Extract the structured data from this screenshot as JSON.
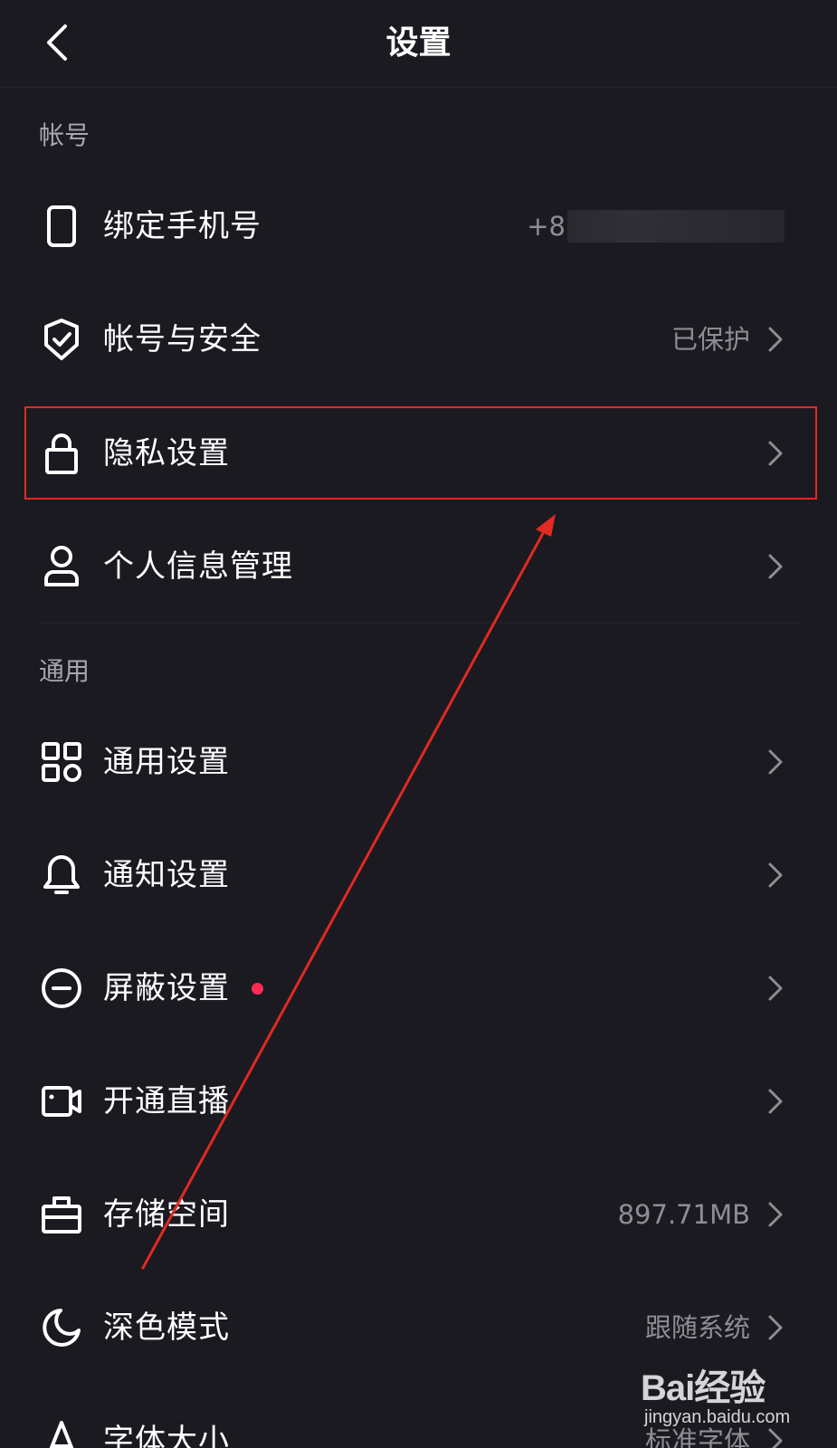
{
  "header": {
    "title": "设置"
  },
  "sections": {
    "account": "帐号",
    "general": "通用"
  },
  "rows": {
    "bind_phone": {
      "label": "绑定手机号",
      "value": "+8",
      "icon": "phone-icon"
    },
    "account_security": {
      "label": "帐号与安全",
      "value": "已保护",
      "icon": "shield-check-icon"
    },
    "privacy": {
      "label": "隐私设置",
      "icon": "lock-icon"
    },
    "personal_info": {
      "label": "个人信息管理",
      "icon": "user-icon"
    },
    "general_settings": {
      "label": "通用设置",
      "icon": "grid-icon"
    },
    "notification": {
      "label": "通知设置",
      "icon": "bell-icon"
    },
    "block": {
      "label": "屏蔽设置",
      "icon": "minus-circle-icon",
      "badge": true
    },
    "live": {
      "label": "开通直播",
      "icon": "video-camera-icon"
    },
    "storage": {
      "label": "存储空间",
      "value": "897.71MB",
      "icon": "briefcase-icon"
    },
    "dark_mode": {
      "label": "深色模式",
      "value": "跟随系统",
      "icon": "moon-icon"
    },
    "font_size": {
      "label": "字体大小",
      "value": "标准字体",
      "icon": "font-a-icon"
    }
  },
  "colors": {
    "background": "#1b1a21",
    "badge": "#fe2c55",
    "annotation": "#e02a22",
    "secondary_text": "#8e8d93"
  },
  "watermark": {
    "logo": "Bai经验",
    "url": "jingyan.baidu.com"
  }
}
